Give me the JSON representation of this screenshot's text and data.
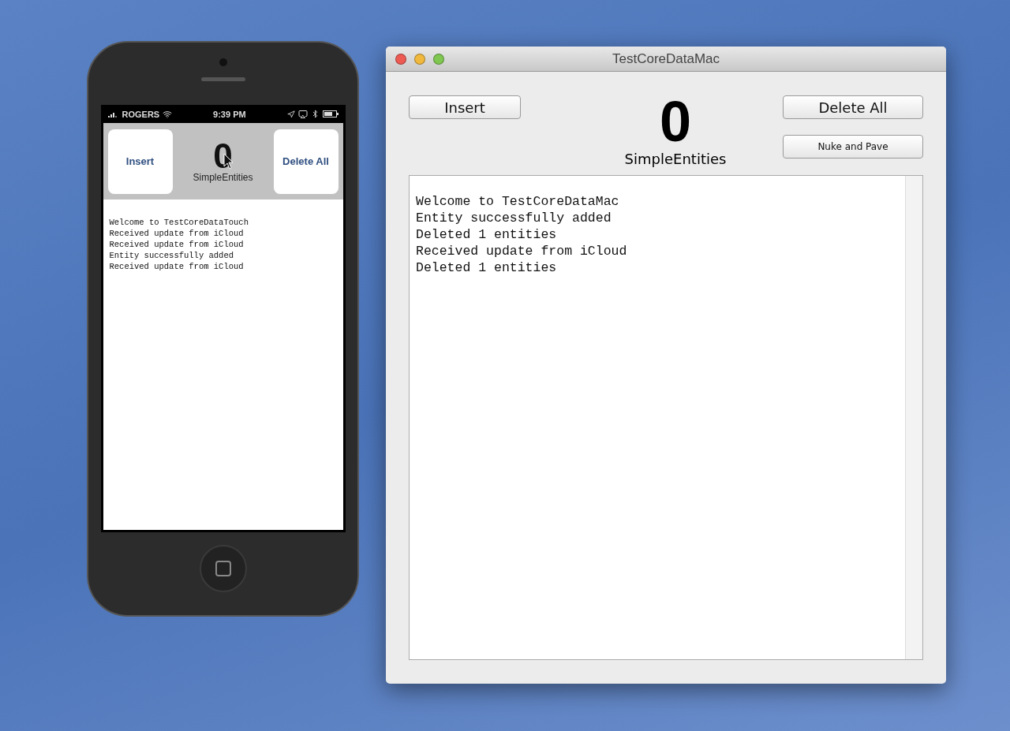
{
  "phone": {
    "status_bar": {
      "carrier": "ROGERS",
      "time": "9:39 PM"
    },
    "toolbar": {
      "left_button": "Insert",
      "right_button": "Delete All",
      "count": "0",
      "count_label": "SimpleEntities"
    },
    "log": [
      "Welcome to TestCoreDataTouch",
      "Received update from iCloud",
      "Received update from iCloud",
      "Entity successfully added",
      "Received update from iCloud"
    ]
  },
  "mac_window": {
    "title": "TestCoreDataMac",
    "insert_button": "Insert",
    "count": "0",
    "count_label": "SimpleEntities",
    "delete_button": "Delete All",
    "nuke_button": "Nuke and Pave",
    "log": [
      "Welcome to TestCoreDataMac",
      "Entity successfully added",
      "Deleted 1 entities",
      "Received update from iCloud",
      "Deleted 1 entities"
    ]
  }
}
